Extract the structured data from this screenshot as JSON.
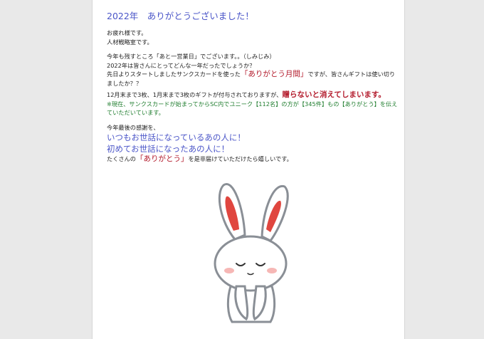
{
  "title": "2022年　ありがとうございました！",
  "greeting": {
    "line1": "お疲れ様です。",
    "line2": "人材戦略室です。"
  },
  "intro": {
    "line1": "今年も残すところ「あと一営業日」でございます。。（しみじみ）",
    "line2": "2022年は皆さんにとってどんな一年だったでしょうか？"
  },
  "thanks_card": {
    "pre": "先日よりスタートしましたサンクスカードを使った",
    "highlight": "「ありがとう月間」",
    "post": "ですが、皆さんギフトは使い切りましたか？？"
  },
  "gift": {
    "pre": "12月末まで3枚、1月末まで3枚のギフトが付与されておりますが、",
    "highlight": "贈らないと消えてしまいます。"
  },
  "note": "※現在、サンクスカードが始まってからSC内でユニーク【112名】の方が【345件】もの【ありがとう】を伝えていただいています。",
  "closing": {
    "line1": "今年最後の感謝を、",
    "line2": "いつもお世話になっているあの人に！",
    "line3": "初めてお世話になったあの人に！",
    "final_pre": "たくさんの",
    "final_highlight": "「ありがとう」",
    "final_post": "を是非届けていただけたら嬉しいです。"
  }
}
